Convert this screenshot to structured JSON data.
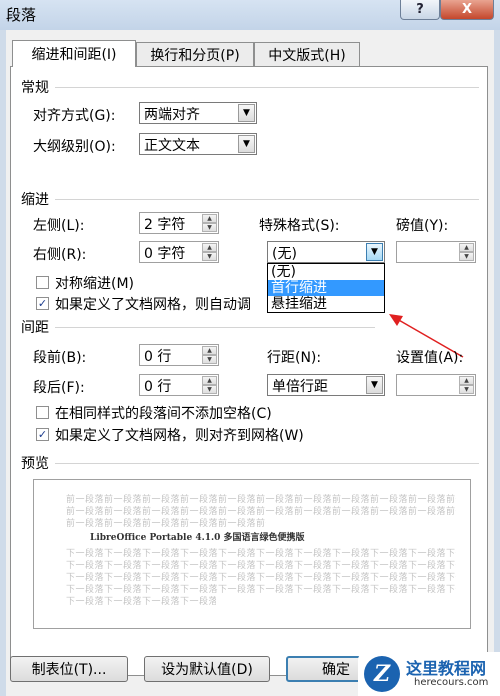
{
  "window": {
    "title": "段落",
    "help_label": "?",
    "close_label": "X"
  },
  "tabs": [
    {
      "label": "缩进和间距(I)",
      "active": true
    },
    {
      "label": "换行和分页(P)",
      "active": false
    },
    {
      "label": "中文版式(H)",
      "active": false
    }
  ],
  "general": {
    "title": "常规",
    "alignment_label": "对齐方式(G):",
    "alignment_value": "两端对齐",
    "outline_label": "大纲级别(O):",
    "outline_value": "正文文本"
  },
  "indent": {
    "title": "缩进",
    "left_label": "左侧(L):",
    "left_value": "2 字符",
    "right_label": "右侧(R):",
    "right_value": "0 字符",
    "special_label": "特殊格式(S):",
    "special_value": "(无)",
    "magnitude_label": "磅值(Y):",
    "magnitude_value": "",
    "special_options": [
      "(无)",
      "首行缩进",
      "悬挂缩进"
    ],
    "special_highlighted_index": 1,
    "mirror_label": "对称缩进(M)",
    "mirror_checked": false,
    "grid_label": "如果定义了文档网格，则自动调",
    "grid_checked": true
  },
  "spacing": {
    "title": "间距",
    "before_label": "段前(B):",
    "before_value": "0 行",
    "after_label": "段后(F):",
    "after_value": "0 行",
    "line_label": "行距(N):",
    "line_value": "单倍行距",
    "at_label": "设置值(A):",
    "at_value": "",
    "no_space_label": "在相同样式的段落间不添加空格(C)",
    "no_space_checked": false,
    "snap_label": "如果定义了文档网格，则对齐到网格(W)",
    "snap_checked": true
  },
  "preview": {
    "title": "预览",
    "prev_line": "前一段落前一段落前一段落前一段落前一段落前一段落前一段落前一段落前一段落前一段落前一段落",
    "sample": "LibreOffice Portable 4.1.0  多国语言绿色便携版",
    "next_line": "下一段落下一段落下一段落下一段落下一段落下一段落下一段落下一段落下一段落下一段落下一段落"
  },
  "buttons": {
    "tabs": "制表位(T)...",
    "default": "设为默认值(D)",
    "ok": "确定"
  },
  "watermark": {
    "logo": "Z",
    "title": "这里教程网",
    "url": "herecours.com"
  },
  "colors": {
    "selection": "#3399ff",
    "annotation_arrow": "#e02020",
    "title_bar": "#c9d8ea"
  }
}
